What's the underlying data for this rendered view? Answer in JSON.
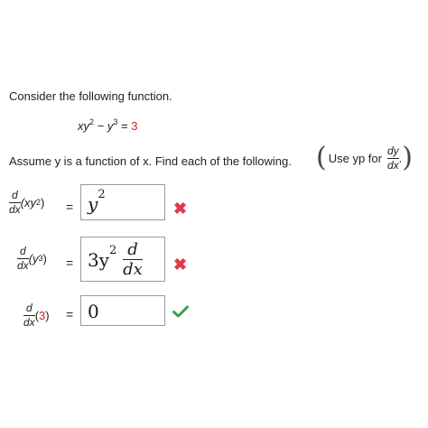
{
  "prompt": {
    "intro": "Consider the following function.",
    "equation_lhs": "xy",
    "eq_exp1": "2",
    "eq_minus": " − y",
    "eq_exp2": "3",
    "eq_equals": " = ",
    "eq_rhs": "3",
    "assume_text": "Assume y is a function of x. Find each of the following.",
    "use_text": "Use yp for",
    "frac_num": "dy",
    "frac_den": "dx",
    "frac_period": "."
  },
  "rows": [
    {
      "d": "d",
      "dx": "dx",
      "expr": "(xy",
      "expr_exp": "2",
      "expr_close": ")",
      "equals": "=",
      "answer": "y",
      "answer_exp": "2",
      "status": "incorrect"
    },
    {
      "d": "d",
      "dx": "dx",
      "expr": "(y",
      "expr_exp": "3",
      "expr_close": ")",
      "equals": "=",
      "answer": "3y",
      "answer_exp": "2",
      "answer_num": "d",
      "answer_den": "dx",
      "status": "incorrect"
    },
    {
      "d": "d",
      "dx": "dx",
      "expr_open": "(",
      "expr_value": "3",
      "expr_close": ")",
      "equals": "=",
      "answer": "0",
      "status": "correct"
    }
  ],
  "colors": {
    "accent_red": "#d0212a",
    "incorrect": "#e0394a",
    "correct": "#3aa043",
    "box_border": "#9a9a9a"
  },
  "icons": {
    "incorrect": "x-mark-icon",
    "correct": "check-mark-icon"
  }
}
